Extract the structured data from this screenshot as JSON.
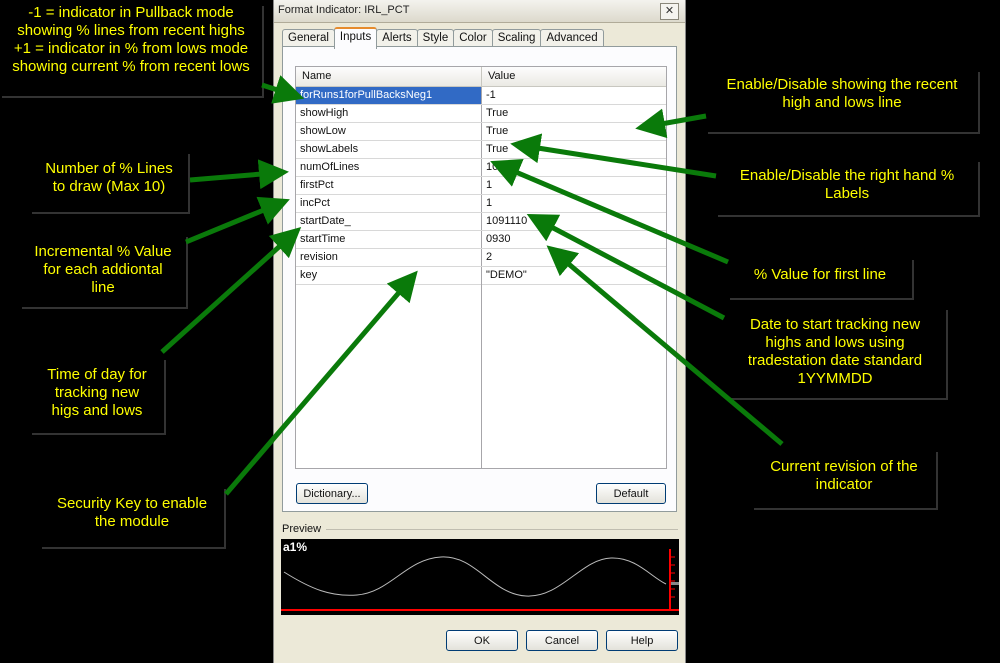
{
  "dialog": {
    "title": "Format Indicator: IRL_PCT",
    "close_label": "✕",
    "tabs": [
      "General",
      "Inputs",
      "Alerts",
      "Style",
      "Color",
      "Scaling",
      "Advanced"
    ],
    "active_tab": "Inputs",
    "grid": {
      "headers": {
        "name": "Name",
        "value": "Value"
      },
      "rows": [
        {
          "name": "forRuns1forPullBacksNeg1",
          "value": "-1"
        },
        {
          "name": "showHigh",
          "value": "True"
        },
        {
          "name": "showLow",
          "value": "True"
        },
        {
          "name": "showLabels",
          "value": "True"
        },
        {
          "name": "numOfLines",
          "value": "10"
        },
        {
          "name": "firstPct",
          "value": "1"
        },
        {
          "name": "incPct",
          "value": "1"
        },
        {
          "name": "startDate_",
          "value": "1091110"
        },
        {
          "name": "startTime",
          "value": "0930"
        },
        {
          "name": "revision",
          "value": "2"
        },
        {
          "name": "key",
          "value": "\"DEMO\""
        }
      ]
    },
    "buttons": {
      "dictionary": "Dictionary...",
      "default": "Default",
      "ok": "OK",
      "cancel": "Cancel",
      "help": "Help"
    },
    "preview": {
      "label": "Preview",
      "chart_label": "a1%"
    }
  },
  "callouts": {
    "mode": "-1 = indicator in Pullback mode\nshowing % lines from recent highs\n+1 = indicator in % from lows mode\nshowing current % from recent lows",
    "num_lines": "Number of % Lines\nto draw (Max 10)",
    "inc_pct": "Incremental % Value\nfor each addiontal\nline",
    "time_of_day": "Time of day for\ntracking new\nhigs and lows",
    "security_key": "Security Key to enable\nthe module",
    "show_high_low": "Enable/Disable showing the recent\nhigh and lows line",
    "labels": "Enable/Disable the right hand %\nLabels",
    "first_pct": "% Value for first line",
    "start_date": "Date to start tracking new\nhighs and lows using\ntradestation date standard\n1YYMMDD",
    "revision": "Current revision of the\nindicator"
  },
  "colors": {
    "callout_text": "#ffff00",
    "arrow": "#0a7a0a",
    "selection": "#316ac5",
    "preview_accent": "#ff0000"
  }
}
